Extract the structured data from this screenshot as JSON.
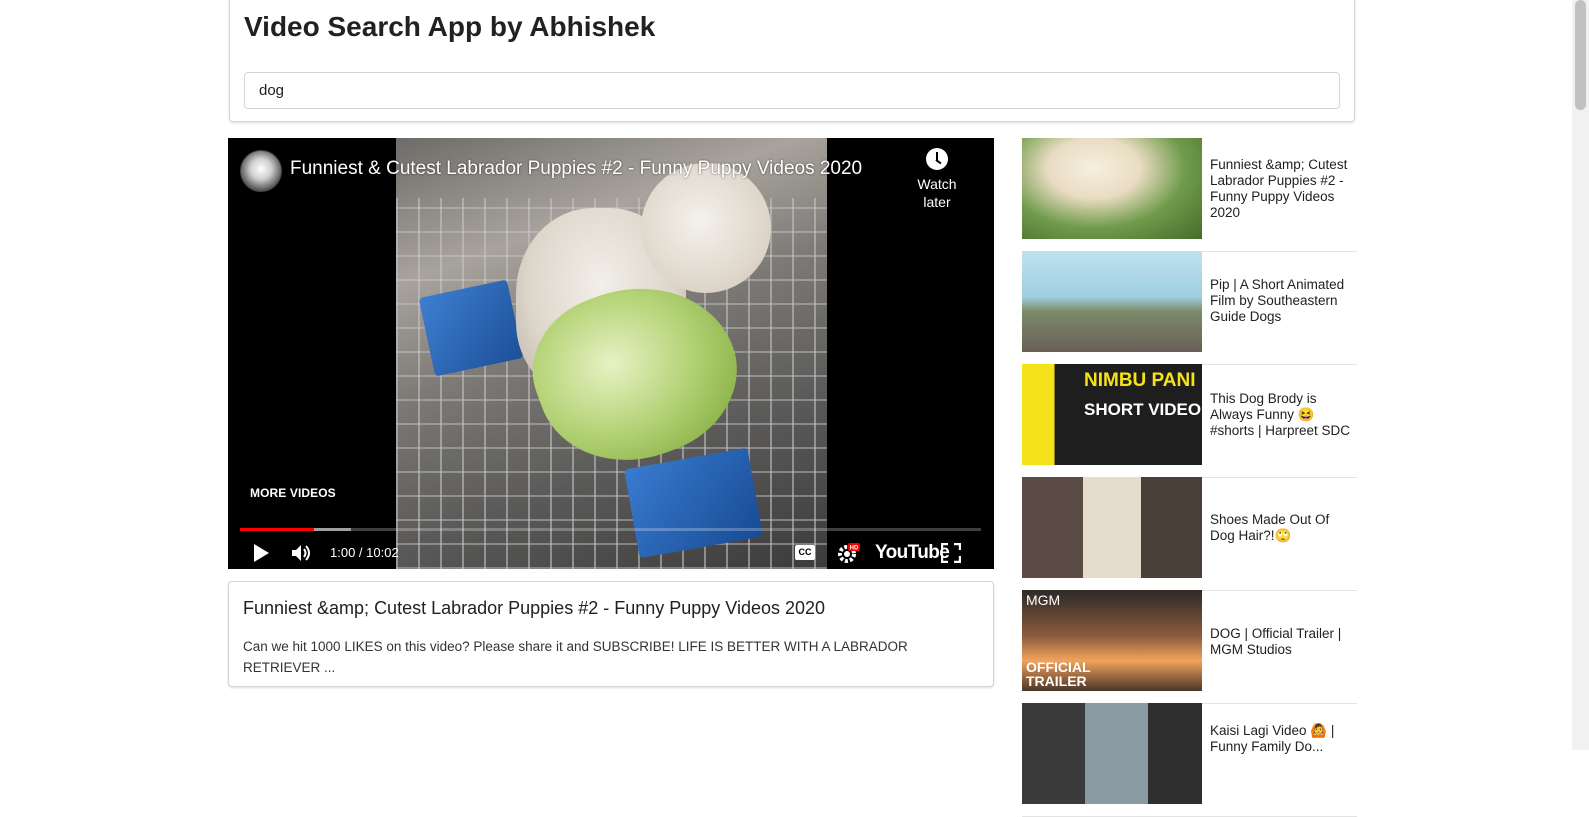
{
  "header": {
    "title": "Video Search App by Abhishek",
    "search_value": "dog"
  },
  "player": {
    "title": "Funniest & Cutest Labrador Puppies #2 - Funny Puppy Videos 2020",
    "watch_later": "Watch later",
    "more_videos": "MORE VIDEOS",
    "time": "1:00 / 10:02",
    "progress_fraction": 0.0997,
    "buffered_fraction": 0.15,
    "logo": "YouTube",
    "cc": "CC",
    "hd_badge": "HD"
  },
  "description": {
    "title": "Funniest &amp; Cutest Labrador Puppies #2 - Funny Puppy Videos 2020",
    "text": "Can we hit 1000 LIKES on this video? Please share it and SUBSCRIBE! LIFE IS BETTER WITH A LABRADOR RETRIEVER ..."
  },
  "list": {
    "items": [
      {
        "title": "Funniest &amp; Cutest Labrador Puppies #2 - Funny Puppy Videos 2020"
      },
      {
        "title": "Pip | A Short Animated Film by Southeastern Guide Dogs"
      },
      {
        "title": "This Dog Brody is Always Funny 😆 #shorts | Harpreet SDC",
        "thumb_text_1": "NIMBU PANI",
        "thumb_text_2": "SHORT VIDEO"
      },
      {
        "title": "Shoes Made Out Of Dog Hair?!🙄"
      },
      {
        "title": "DOG | Official Trailer | MGM Studios",
        "thumb_text_1": "MGM",
        "thumb_text_2": "OFFICIAL TRAILER"
      },
      {
        "title": "Kaisi Lagi Video 🙆 | Funny Family Do..."
      }
    ]
  },
  "colors": {
    "progress": "#ff0000",
    "border": "#d4d4d5"
  }
}
